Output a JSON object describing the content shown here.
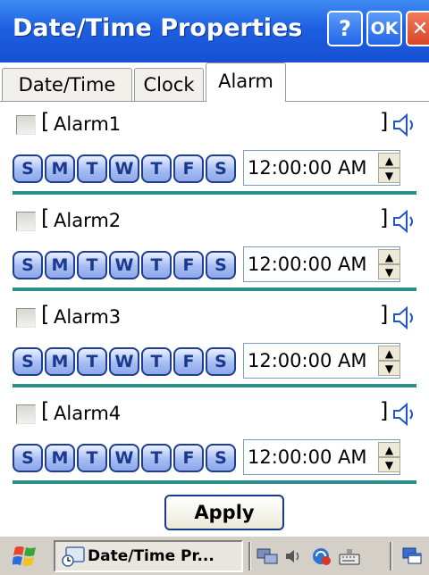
{
  "window": {
    "title": "Date/Time Properties",
    "help_label": "?",
    "ok_label": "OK",
    "close_label": "✕"
  },
  "tabs": [
    {
      "label": "Date/Time",
      "active": false
    },
    {
      "label": "Clock",
      "active": false
    },
    {
      "label": "Alarm",
      "active": true
    }
  ],
  "alarms": [
    {
      "name": "Alarm1",
      "enabled": false,
      "time": "12:00:00 AM"
    },
    {
      "name": "Alarm2",
      "enabled": false,
      "time": "12:00:00 AM"
    },
    {
      "name": "Alarm3",
      "enabled": false,
      "time": "12:00:00 AM"
    },
    {
      "name": "Alarm4",
      "enabled": false,
      "time": "12:00:00 AM"
    }
  ],
  "days": [
    "S",
    "M",
    "T",
    "W",
    "T",
    "F",
    "S"
  ],
  "brackets": {
    "open": "[",
    "close": "]"
  },
  "spin": {
    "up": "▲",
    "down": "▼"
  },
  "apply_label": "Apply",
  "taskbar": {
    "task_label": "Date/Time Pr...",
    "icons": [
      "start-logo-icon",
      "date-time-app-icon",
      "network-icon",
      "volume-icon",
      "sync-icon",
      "keyboard-icon",
      "desktop-icon"
    ]
  },
  "colors": {
    "titlebar": "#1d5fe0",
    "separator": "#2a8f8b",
    "day_button": "#a6bdf3",
    "day_text": "#1b3a8e"
  }
}
